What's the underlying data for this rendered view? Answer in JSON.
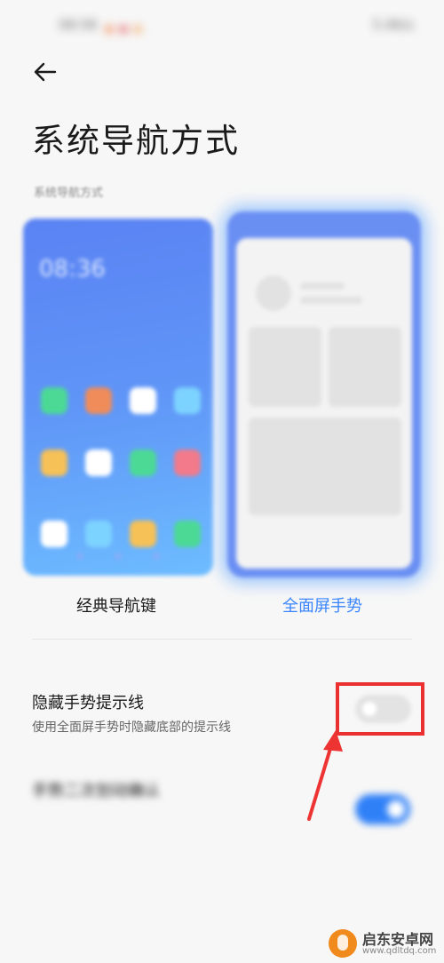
{
  "status_bar": {
    "time": "08:58",
    "right_text": "5.0K/s"
  },
  "header": {
    "title": "系统导航方式"
  },
  "section": {
    "label": "系统导航方式"
  },
  "preview": {
    "classic_clock": "08:36",
    "app_colors": [
      "#4cd996",
      "#f08c5a",
      "#ffffff",
      "#7dd3ff",
      "#f6c157",
      "#ffffff",
      "#4cd996",
      "#f27a8a",
      "#ffffff",
      "#7dd3ff",
      "#f6c157",
      "#4cd996"
    ]
  },
  "nav_options": {
    "classic_label": "经典导航键",
    "gesture_label": "全面屏手势",
    "selected": "gesture",
    "selected_color": "#3a85ff"
  },
  "settings": {
    "hide_gesture_line": {
      "title": "隐藏手势提示线",
      "description": "使用全面屏手势时隐藏底部的提示线",
      "enabled": false
    },
    "swipe_confirm": {
      "title": "手势二次划动确认",
      "description": "",
      "enabled": true
    }
  },
  "annotation": {
    "box_color": "#ea3030"
  },
  "watermark": {
    "name": "启东安卓网",
    "url": "www.qdltdq.com"
  }
}
